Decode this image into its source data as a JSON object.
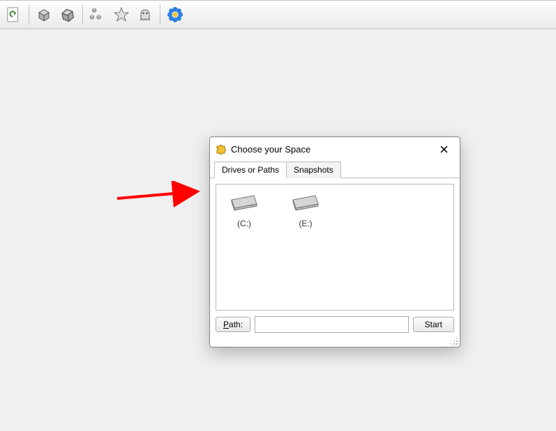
{
  "dialog": {
    "title": "Choose your Space",
    "tabs": {
      "drives": "Drives or Paths",
      "snapshots": "Snapshots"
    },
    "drives": [
      {
        "label": "(C:)"
      },
      {
        "label": "(E:)"
      }
    ],
    "path_button_prefix": "P",
    "path_button_suffix": "ath:",
    "path_value": "",
    "start_button": "Start"
  },
  "toolbar_icons": {
    "refresh": "refresh-icon",
    "cube": "cube-icon",
    "cube2": "cube-angled-icon",
    "cubes": "cubes-icon",
    "star": "star-icon",
    "ghost": "ghost-icon",
    "flower": "flower-icon"
  }
}
